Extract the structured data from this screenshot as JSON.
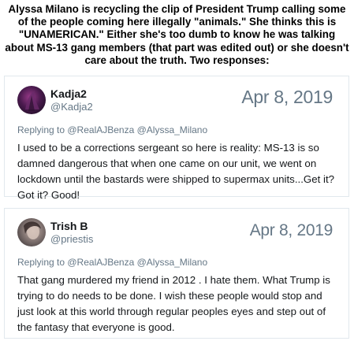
{
  "headline": "Alyssa Milano is recycling the clip of President Trump calling some of the people coming here illegally \"animals.\" She thinks this is \"UNAMERICAN.\" Either she's too dumb to know he was talking about MS-13 gang members (that part was edited out) or she doesn't care about the truth. Two responses:",
  "tweets": [
    {
      "name": "Kadja2",
      "handle": "@Kadja2",
      "date": "Apr 8, 2019",
      "replying_to": "Replying to @RealAJBenza @Alyssa_Milano",
      "text": "I used to be a corrections sergeant so here is reality: MS-13 is so damned dangerous that when one came on our unit, we went on lockdown until the bastards were shipped to supermax units...Get it? Got it? Good!"
    },
    {
      "name": "Trish B",
      "handle": "@priestis",
      "date": "Apr 8, 2019",
      "replying_to": "Replying to @RealAJBenza @Alyssa_Milano",
      "text": "That gang murdered my friend in 2012 . I hate them. What Trump is trying to do needs to be done. I wish these people would stop and just look at this world through regular peoples eyes and step out of the fantasy that everyone is good."
    }
  ],
  "colors": {
    "text": "#14171a",
    "muted": "#657786",
    "border": "#e1e8ed"
  }
}
